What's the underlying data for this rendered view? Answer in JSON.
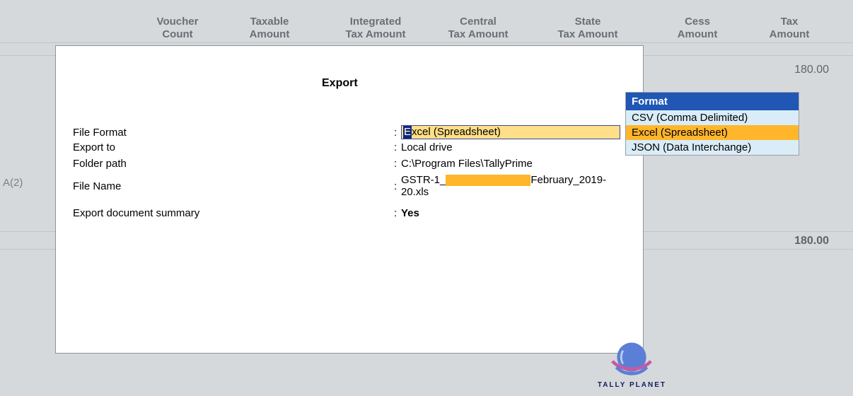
{
  "background": {
    "headers": {
      "voucher": "Voucher Count",
      "taxable": "Taxable Amount",
      "integrated_tax": "Integrated Tax Amount",
      "central_tax": "Central Tax Amount",
      "state_tax": "State Tax Amount",
      "cess": "Cess Amount",
      "tax_amount": "Tax Amount"
    },
    "left_label": "A(2)",
    "row_value_top": "180.00",
    "row_value_bottom": "180.00"
  },
  "modal": {
    "title": "Export",
    "fields": {
      "file_format": {
        "label": "File Format",
        "value_first": "E",
        "value_rest": "xcel (Spreadsheet)"
      },
      "export_to": {
        "label": "Export to",
        "value": "Local drive"
      },
      "folder_path": {
        "label": "Folder path",
        "value": "C:\\Program Files\\TallyPrime"
      },
      "file_name": {
        "label": "File Name",
        "prefix": "GSTR-1_",
        "suffix": "February_2019-20.xls"
      },
      "export_summary": {
        "label": "Export document summary",
        "value": "Yes"
      }
    }
  },
  "dropdown": {
    "header": "Format",
    "items": [
      "CSV (Comma Delimited)",
      "Excel (Spreadsheet)",
      "JSON (Data Interchange)"
    ],
    "selected_index": 1
  },
  "logo_text": "TALLY PLANET"
}
